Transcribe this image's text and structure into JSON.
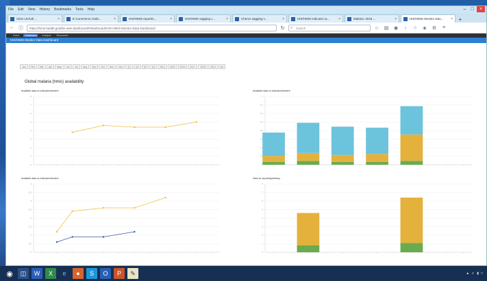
{
  "browser": {
    "menu": [
      "File",
      "Edit",
      "View",
      "History",
      "Bookmarks",
      "Tools",
      "Help"
    ],
    "tabs": [
      {
        "label": "Citrix UC/UE ..."
      },
      {
        "label": "E-Commerce Ande..."
      },
      {
        "label": "HIS/HMIS reportin..."
      },
      {
        "label": "HIS/HMIS sagging c..."
      },
      {
        "label": "Chemo sagging c..."
      },
      {
        "label": "HIS/HMIS indicator ra..."
      },
      {
        "label": "Malaria: 2018 ..."
      },
      {
        "label": "HIS/HMIS Monitor Das..."
      }
    ],
    "new_tab": "+",
    "address": "https://hmis.health.go/dhis-web-dashboard/#/dashboard/HIS-HMIS-Monitor-Data-Dashboard",
    "search_placeholder": "Search"
  },
  "app": {
    "nav": [
      "Home",
      "Dashboard",
      "Analysis",
      "Resources"
    ],
    "title": "HIS/HMIS Monitor Data Dashboard"
  },
  "filters": [
    "Jan",
    "Feb",
    "Mar",
    "Apr",
    "May",
    "Jun",
    "Jul",
    "Aug",
    "Sep",
    "Oct",
    "Nov",
    "Dec",
    "Q1",
    "Q2",
    "Q3",
    "Q4",
    "2014",
    "2015",
    "2016",
    "2017",
    "2018",
    "2019",
    "All"
  ],
  "section_title": "Global malaria (hmis) availability",
  "chart_data": [
    {
      "type": "line",
      "title": "Available data on indicator/element",
      "subtitle": "",
      "x": [
        "P1",
        "P2",
        "P3",
        "P4",
        "P5",
        "P6",
        "P7",
        "P8",
        "P9",
        "P10",
        "P11",
        "P12"
      ],
      "series": [
        {
          "values": [
            null,
            null,
            3.8,
            null,
            4.6,
            null,
            4.4,
            null,
            4.4,
            null,
            5.0,
            null
          ]
        }
      ],
      "ylim": [
        0,
        8
      ],
      "xlabel": "",
      "ylabel": "",
      "color": "#f0c040"
    },
    {
      "type": "bar",
      "stacked": true,
      "title": "Available data on indicator/element",
      "subtitle": "",
      "categories": [
        "P1",
        "P2",
        "P3",
        "P4",
        "P5",
        "P6",
        "P7",
        "P8",
        "P9",
        "P10",
        "P11",
        "P12"
      ],
      "series": [
        {
          "values": [
            0.3,
            null,
            0.4,
            null,
            0.3,
            null,
            0.3,
            null,
            0.4,
            null,
            null,
            null
          ],
          "color": "#6aab4f"
        },
        {
          "values": [
            0.6,
            null,
            0.8,
            null,
            0.7,
            null,
            0.8,
            null,
            2.7,
            null,
            null,
            null
          ],
          "color": "#e4b23c"
        },
        {
          "values": [
            2.4,
            null,
            3.1,
            null,
            2.9,
            null,
            2.7,
            null,
            2.9,
            null,
            null,
            null
          ],
          "color": "#6cc3dc"
        }
      ],
      "ylim": [
        0,
        7
      ],
      "ylabel": "",
      "xlabel": ""
    },
    {
      "type": "line",
      "title": "Available data on indicator/element",
      "subtitle": "",
      "x": [
        "P1",
        "P2",
        "P3",
        "P4",
        "P5",
        "P6",
        "P7",
        "P8",
        "P9",
        "P10",
        "P11",
        "P12"
      ],
      "series": [
        {
          "values": [
            null,
            1.2,
            2.4,
            null,
            2.6,
            null,
            2.6,
            null,
            3.2,
            null,
            null,
            null
          ],
          "color": "#f0c040"
        },
        {
          "values": [
            null,
            0.6,
            0.9,
            null,
            0.9,
            null,
            1.2,
            null,
            null,
            null,
            null,
            null
          ],
          "color": "#3a5a9a"
        }
      ],
      "ylim": [
        0,
        4
      ],
      "ylabel": "",
      "xlabel": ""
    },
    {
      "type": "bar",
      "stacked": true,
      "title": "Data on reporting/delivery",
      "subtitle": "",
      "categories": [
        "P1",
        "P2",
        "P3",
        "P4",
        "P5",
        "P6",
        "P7",
        "P8",
        "P9",
        "P10",
        "P11",
        "P12"
      ],
      "series": [
        {
          "values": [
            null,
            null,
            0.8,
            null,
            null,
            null,
            null,
            null,
            1.1,
            null,
            null,
            null
          ],
          "color": "#6aab4f"
        },
        {
          "values": [
            null,
            null,
            3.8,
            null,
            null,
            null,
            null,
            null,
            5.3,
            null,
            null,
            null
          ],
          "color": "#e4b23c"
        }
      ],
      "ylim": [
        0,
        8
      ],
      "ylabel": "",
      "xlabel": ""
    }
  ]
}
